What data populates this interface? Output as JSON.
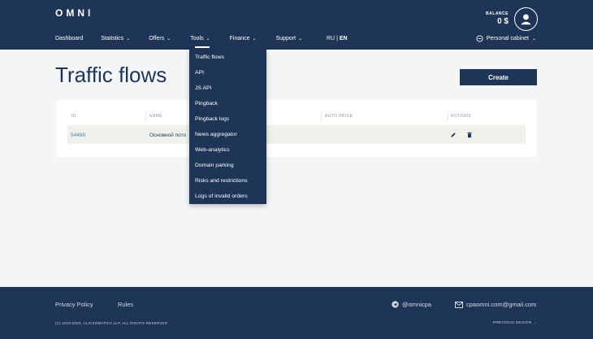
{
  "header": {
    "logo": "OMNI",
    "balance_label": "BALANCE",
    "balance_value": "0 $",
    "nav": [
      {
        "label": "Dashboard",
        "chevron": ""
      },
      {
        "label": "Statistics",
        "chevron": "⌄"
      },
      {
        "label": "Offers",
        "chevron": "⌄"
      },
      {
        "label": "Tools",
        "chevron": "⌄"
      },
      {
        "label": "Finance",
        "chevron": "⌄"
      },
      {
        "label": "Support",
        "chevron": "⌄"
      }
    ],
    "lang_ru": "RU",
    "lang_sep": " | ",
    "lang_en": "EN",
    "cabinet_label": "Personal cabinet",
    "cabinet_chevron": "⌄"
  },
  "main": {
    "title": "Traffic flows",
    "create_label": "Create"
  },
  "table": {
    "columns": [
      "ID",
      "NAME",
      "AUTO PRICE",
      "ACTIONS"
    ],
    "rows": [
      {
        "id": "54486",
        "name": "Основной пото"
      }
    ]
  },
  "tools_menu": [
    "Traffic flows",
    "API",
    "JS API",
    "Pingback",
    "Pingback logs",
    "News aggregator",
    "Web-analytics",
    "Domain parking",
    "Risks and restrictions",
    "Logs of invalid orders"
  ],
  "footer": {
    "privacy": "Privacy Policy",
    "rules": "Rules",
    "telegram": "@omnicpa",
    "email": "cpaomni.com@gmail.com",
    "copyright": "(C) 2013-2024, CLICKOMATICA LLP, ALL RIGHTS RESERVED",
    "previous_design": "PREVIOUS DESIGN →"
  },
  "colors": {
    "brand": "#1e3557",
    "row_bg": "#eef2ea",
    "page_bg": "#f4f5f7"
  }
}
